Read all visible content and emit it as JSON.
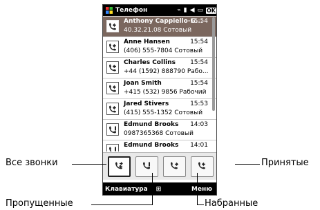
{
  "status_bar": {
    "title": "Телефон",
    "ok_label": "OK"
  },
  "call_log": [
    {
      "name": "Anthony Cappiello-G...",
      "time": "15:54",
      "detail": "40.32.21.08 Сотовый",
      "icon": "incoming-call-icon",
      "selected": true
    },
    {
      "name": "Anne Hansen",
      "time": "15:54",
      "detail": "(406) 555-7804 Сотовый",
      "icon": "incoming-call-icon",
      "selected": false
    },
    {
      "name": "Charles Collins",
      "time": "15:54",
      "detail": "+44 (1592) 888790 Рабо...",
      "icon": "incoming-call-icon",
      "selected": false
    },
    {
      "name": "Joan Smith",
      "time": "15:54",
      "detail": "+415 (532) 9856 Рабочий",
      "icon": "incoming-call-icon",
      "selected": false
    },
    {
      "name": "Jared Stivers",
      "time": "15:53",
      "detail": "(415) 555-1352 Сотовый",
      "icon": "incoming-call-icon",
      "selected": false
    },
    {
      "name": "Edmund Brooks",
      "time": "14:03",
      "detail": "0987365368 Сотовый",
      "icon": "missed-call-icon",
      "selected": false
    },
    {
      "name": "Edmund Brooks",
      "time": "14:01",
      "detail": "",
      "icon": "missed-call-icon",
      "selected": false
    }
  ],
  "filters": [
    {
      "icon": "all-calls-icon",
      "active": true
    },
    {
      "icon": "missed-calls-icon",
      "active": false
    },
    {
      "icon": "outgoing-calls-icon",
      "active": false
    },
    {
      "icon": "received-calls-icon",
      "active": false
    }
  ],
  "softkeys": {
    "left": "Клавиатура",
    "right": "Меню"
  },
  "callouts": {
    "all_calls": "Все звонки",
    "received": "Принятые",
    "missed": "Пропущенные",
    "outgoing": "Набранные"
  }
}
